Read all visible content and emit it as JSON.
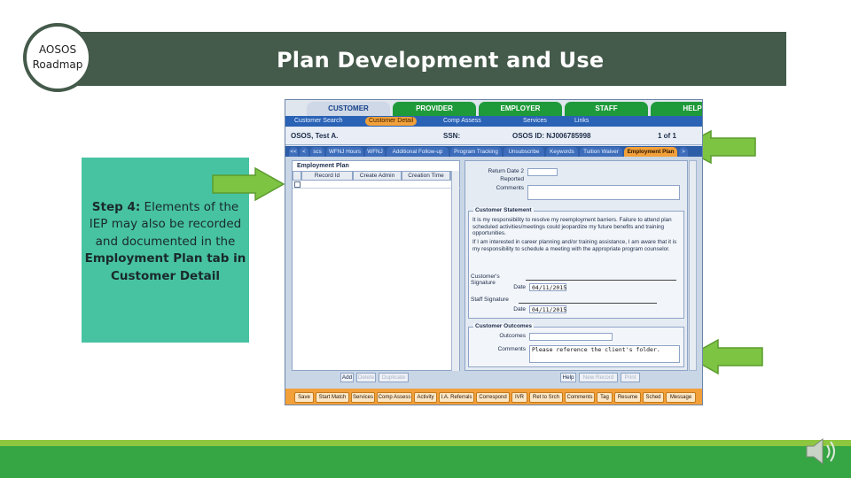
{
  "slide": {
    "title": "Plan Development and Use",
    "logo_line1": "AOSOS",
    "logo_line2": "Roadmap",
    "step_label": "Step 4:",
    "step_text": " Elements of the IEP may also be recorded and documented in the ",
    "step_bold": "Employment Plan tab in Customer Detail"
  },
  "colors": {
    "header_bg": "#445a4a",
    "step_bg": "#47c3a2",
    "arrow_fill": "#7dc443",
    "footer_green": "#36a544",
    "footer_light": "#8ec63f"
  },
  "app": {
    "top_tabs": [
      "CUSTOMER",
      "PROVIDER",
      "EMPLOYER",
      "STAFF",
      "HELP"
    ],
    "sub_nav": [
      "Customer Search",
      "Customer Detail",
      "Comp Assess",
      "Services",
      "Links"
    ],
    "customer_name": "OSOS, Test A.",
    "ssn_label": "SSN:",
    "osos_id": "OSOS ID: NJ006785998",
    "record_count": "1 of 1",
    "tabs": [
      "<<",
      "<",
      "scs",
      "WFNJ Hours",
      "WFNJ",
      "Additional Follow-up",
      "Program Tracking",
      "Unsubscribe",
      "Keywords",
      "Tuition Waiver",
      "Employment Plan",
      ">"
    ],
    "left_panel": {
      "title": "Employment Plan",
      "columns": [
        "Record Id",
        "Create Admin",
        "Creation Time",
        ">"
      ]
    },
    "right_panel": {
      "return_date_label": "Return Date 2",
      "reported_label": "Reported",
      "comments_label": "Comments",
      "statement_title": "Customer Statement",
      "statement_p1": "It is my responsibility to resolve my reemployment barriers. Failure to attend plan scheduled activities/meetings could jeopardize my future benefits and training opportunities.",
      "statement_p2": "If I am interested in career planning and/or training assistance, I am aware that it is my responsibility to schedule a meeting with the appropriate program counselor.",
      "customer_signature_label": "Customer's Signature",
      "date_label": "Date",
      "date_value_1": "04/11/2015",
      "staff_signature_label": "Staff Signature",
      "date_value_2": "04/11/2015",
      "outcomes_title": "Customer Outcomes",
      "outcomes_label": "Outcomes",
      "outcomes_comments_label": "Comments",
      "outcomes_comments_value": "Please reference the client's folder."
    },
    "left_buttons": [
      "Add",
      "Delete",
      "Duplicate"
    ],
    "right_buttons": [
      "Help",
      "New Record",
      "Print"
    ],
    "bottom_buttons": [
      "Save",
      "Start Match",
      "Services",
      "Comp Assess",
      "Activity",
      "I.A. Referrals",
      "Correspond",
      "IVR",
      "Ret to Srch",
      "Comments",
      "Tag",
      "Resume",
      "Sched",
      "Message"
    ]
  }
}
